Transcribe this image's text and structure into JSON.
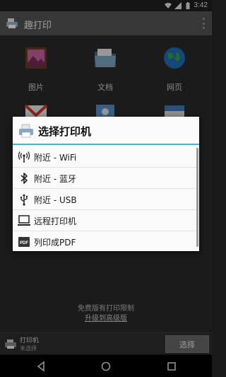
{
  "status_bar": {
    "time": "3:42"
  },
  "app": {
    "title": "趣打印"
  },
  "grid": [
    {
      "label": "图片",
      "icon": "pictures-icon"
    },
    {
      "label": "文档",
      "icon": "documents-folder-icon"
    },
    {
      "label": "网页",
      "icon": "globe-icon"
    }
  ],
  "promo": {
    "line1": "免费版有打印限制",
    "line2": "升级到高级版"
  },
  "printer": {
    "label": "打印机",
    "status": "未选择",
    "select_label": "选择"
  },
  "dialog": {
    "title": "选择打印机",
    "options": [
      {
        "label": "附近 - WiFi",
        "icon": "wifi-antenna-icon"
      },
      {
        "label": "附近 - 蓝牙",
        "icon": "bluetooth-icon"
      },
      {
        "label": "附近 - USB",
        "icon": "usb-icon"
      },
      {
        "label": "远程打印机",
        "icon": "computer-icon"
      },
      {
        "label": "列印成PDF",
        "icon": "pdf-icon"
      }
    ]
  },
  "colors": {
    "accent": "#3fb6d8",
    "app_bar": "#555555",
    "background": "#2a2a2a"
  }
}
